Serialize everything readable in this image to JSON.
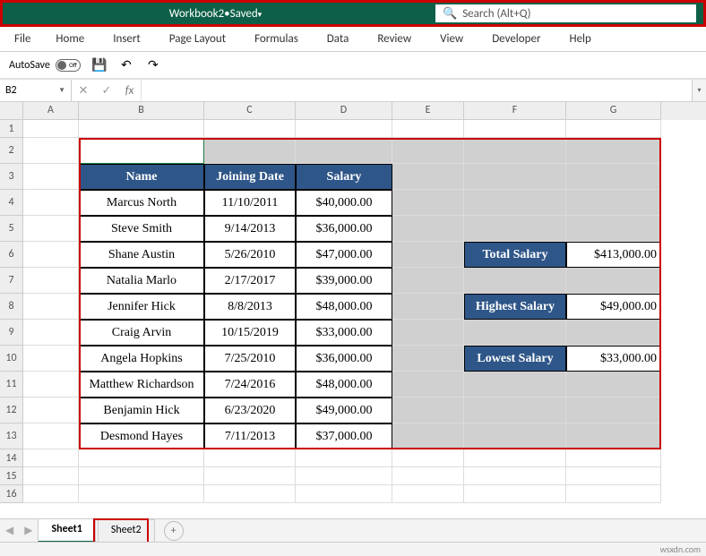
{
  "titlebar": {
    "workbook_name": "Workbook2",
    "status": "Saved",
    "search_placeholder": "Search (Alt+Q)"
  },
  "ribbon": {
    "tabs": [
      "File",
      "Home",
      "Insert",
      "Page Layout",
      "Formulas",
      "Data",
      "Review",
      "View",
      "Developer",
      "Help"
    ]
  },
  "qat": {
    "autosave_label": "AutoSave",
    "autosave_state": "Off"
  },
  "namebox": {
    "ref": "B2"
  },
  "columns": [
    "A",
    "B",
    "C",
    "D",
    "E",
    "F",
    "G"
  ],
  "row_numbers": [
    "1",
    "2",
    "3",
    "4",
    "5",
    "6",
    "7",
    "8",
    "9",
    "10",
    "11",
    "12",
    "13",
    "14",
    "15",
    "16"
  ],
  "table": {
    "headers": {
      "name": "Name",
      "date": "Joining Date",
      "salary": "Salary"
    },
    "rows": [
      {
        "name": "Marcus North",
        "date": "11/10/2011",
        "salary": "$40,000.00"
      },
      {
        "name": "Steve Smith",
        "date": "9/14/2013",
        "salary": "$36,000.00"
      },
      {
        "name": "Shane Austin",
        "date": "5/26/2010",
        "salary": "$47,000.00"
      },
      {
        "name": "Natalia Marlo",
        "date": "2/17/2017",
        "salary": "$39,000.00"
      },
      {
        "name": "Jennifer Hick",
        "date": "8/8/2013",
        "salary": "$48,000.00"
      },
      {
        "name": "Craig Arvin",
        "date": "10/15/2019",
        "salary": "$33,000.00"
      },
      {
        "name": "Angela Hopkins",
        "date": "7/25/2010",
        "salary": "$36,000.00"
      },
      {
        "name": "Matthew Richardson",
        "date": "7/24/2016",
        "salary": "$48,000.00"
      },
      {
        "name": "Benjamin Hick",
        "date": "6/23/2020",
        "salary": "$49,000.00"
      },
      {
        "name": "Desmond Hayes",
        "date": "7/11/2013",
        "salary": "$37,000.00"
      }
    ]
  },
  "summary": {
    "total_label": "Total Salary",
    "total_value": "$413,000.00",
    "high_label": "Highest Salary",
    "high_value": "$49,000.00",
    "low_label": "Lowest Salary",
    "low_value": "$33,000.00"
  },
  "tabs": {
    "active": "Sheet1",
    "other": "Sheet2"
  },
  "watermark": "wsxdn.com"
}
